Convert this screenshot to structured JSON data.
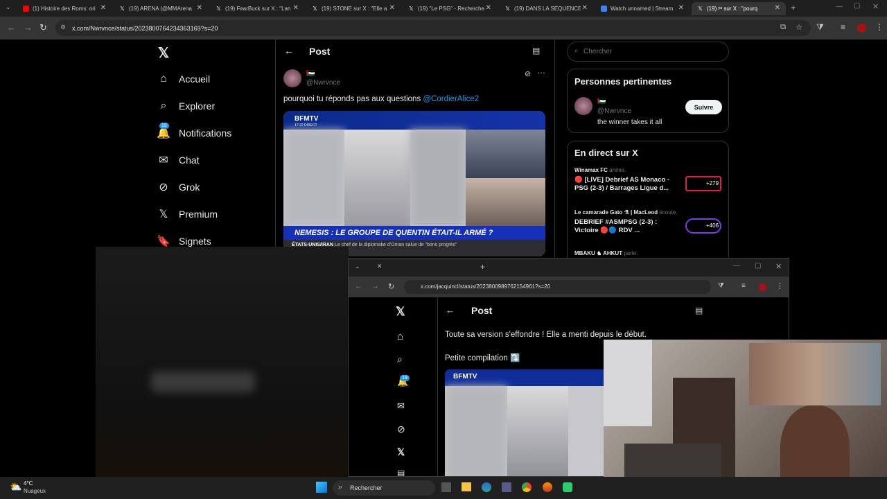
{
  "browser": {
    "tabs": [
      {
        "label": "(1) Histoire des Roms: ori",
        "icon": "youtube-icon",
        "color": "#ff0000"
      },
      {
        "label": "(19) ARENA (@MMArena",
        "icon": "x-icon",
        "color": "#ffffff"
      },
      {
        "label": "(19) FearBuck sur X : \"Lan",
        "icon": "x-icon",
        "color": "#ffffff"
      },
      {
        "label": "(19) STONE sur X : \"Elle a",
        "icon": "x-icon",
        "color": "#ffffff"
      },
      {
        "label": "(19) \"Le PSG\" - Recherche",
        "icon": "x-icon",
        "color": "#ffffff"
      },
      {
        "label": "(19) DANS LA SÉQUENCE",
        "icon": "x-icon",
        "color": "#ffffff"
      },
      {
        "label": "Watch unnamed | Stream",
        "icon": "stream-icon",
        "color": "#3b82f6"
      },
      {
        "label": "(19) ᵖˢ sur X : \"pourq",
        "icon": "x-icon",
        "color": "#ffffff"
      }
    ],
    "url": "x.com/Nwrvnce/status/2023800764234363169?s=20"
  },
  "sidebar": {
    "logo": "𝕏",
    "items": [
      {
        "label": "Accueil",
        "icon": "home-icon"
      },
      {
        "label": "Explorer",
        "icon": "search-icon"
      },
      {
        "label": "Notifications",
        "icon": "bell-icon",
        "badge": "19"
      },
      {
        "label": "Chat",
        "icon": "mail-icon"
      },
      {
        "label": "Grok",
        "icon": "grok-icon"
      },
      {
        "label": "Premium",
        "icon": "x-icon"
      },
      {
        "label": "Signets",
        "icon": "bookmark-icon"
      }
    ]
  },
  "post": {
    "header": "Post",
    "flag": "🇵🇸",
    "handle": "@Nwrvnce",
    "text": "pourquoi tu réponds pas aux questions",
    "mention": "@CordierAlice2",
    "media": {
      "channel": "BFMTV",
      "time": "17:22 DIRECT",
      "headline": "NEMESIS : LE GROUPE DE QUENTIN ÉTAIT-IL ARMÉ ?",
      "ticker_label": "ÉTATS-UNIS/IRAN",
      "ticker": "Le chef de la diplomatie d'Oman salue de \"bons progrès\""
    }
  },
  "right": {
    "search_placeholder": "Chercher",
    "relevant_title": "Personnes pertinentes",
    "relevant_person": {
      "flag": "🇵🇸",
      "handle": "@Nwrvnce",
      "bio": "the winner takes it all",
      "follow": "Suivre"
    },
    "live_title": "En direct sur X",
    "live": [
      {
        "host": "Winamax FC",
        "meta": "anime.",
        "title": "🔴 [LIVE] Debrief AS Monaco - PSG (2-3) / Barrages Ligue d...",
        "count": "+279",
        "accent": "#e11d48"
      },
      {
        "host": "Le camarade Gato ⚗ | MacLeod",
        "meta": "écoute.",
        "title": "DEBRIEF #ASMPSG (2-3) : Victoire 🔴🔵 RDV ...",
        "count": "+406",
        "accent": "#7c3aed"
      },
      {
        "host": "MBAKU ♞ AHKUT",
        "meta": "parle."
      }
    ]
  },
  "window2": {
    "url": "x.com/jacquincl/status/2023800989762154961?s=20",
    "header": "Post",
    "text1": "Toute sa version s'effondre ! Elle a menti depuis le début.",
    "text2": "Petite compilation ⤵️",
    "media_channel": "BFMTV",
    "badge": "19"
  },
  "taskbar": {
    "weather_temp": "4°C",
    "weather_desc": "Nuageux",
    "search": "Rechercher"
  }
}
